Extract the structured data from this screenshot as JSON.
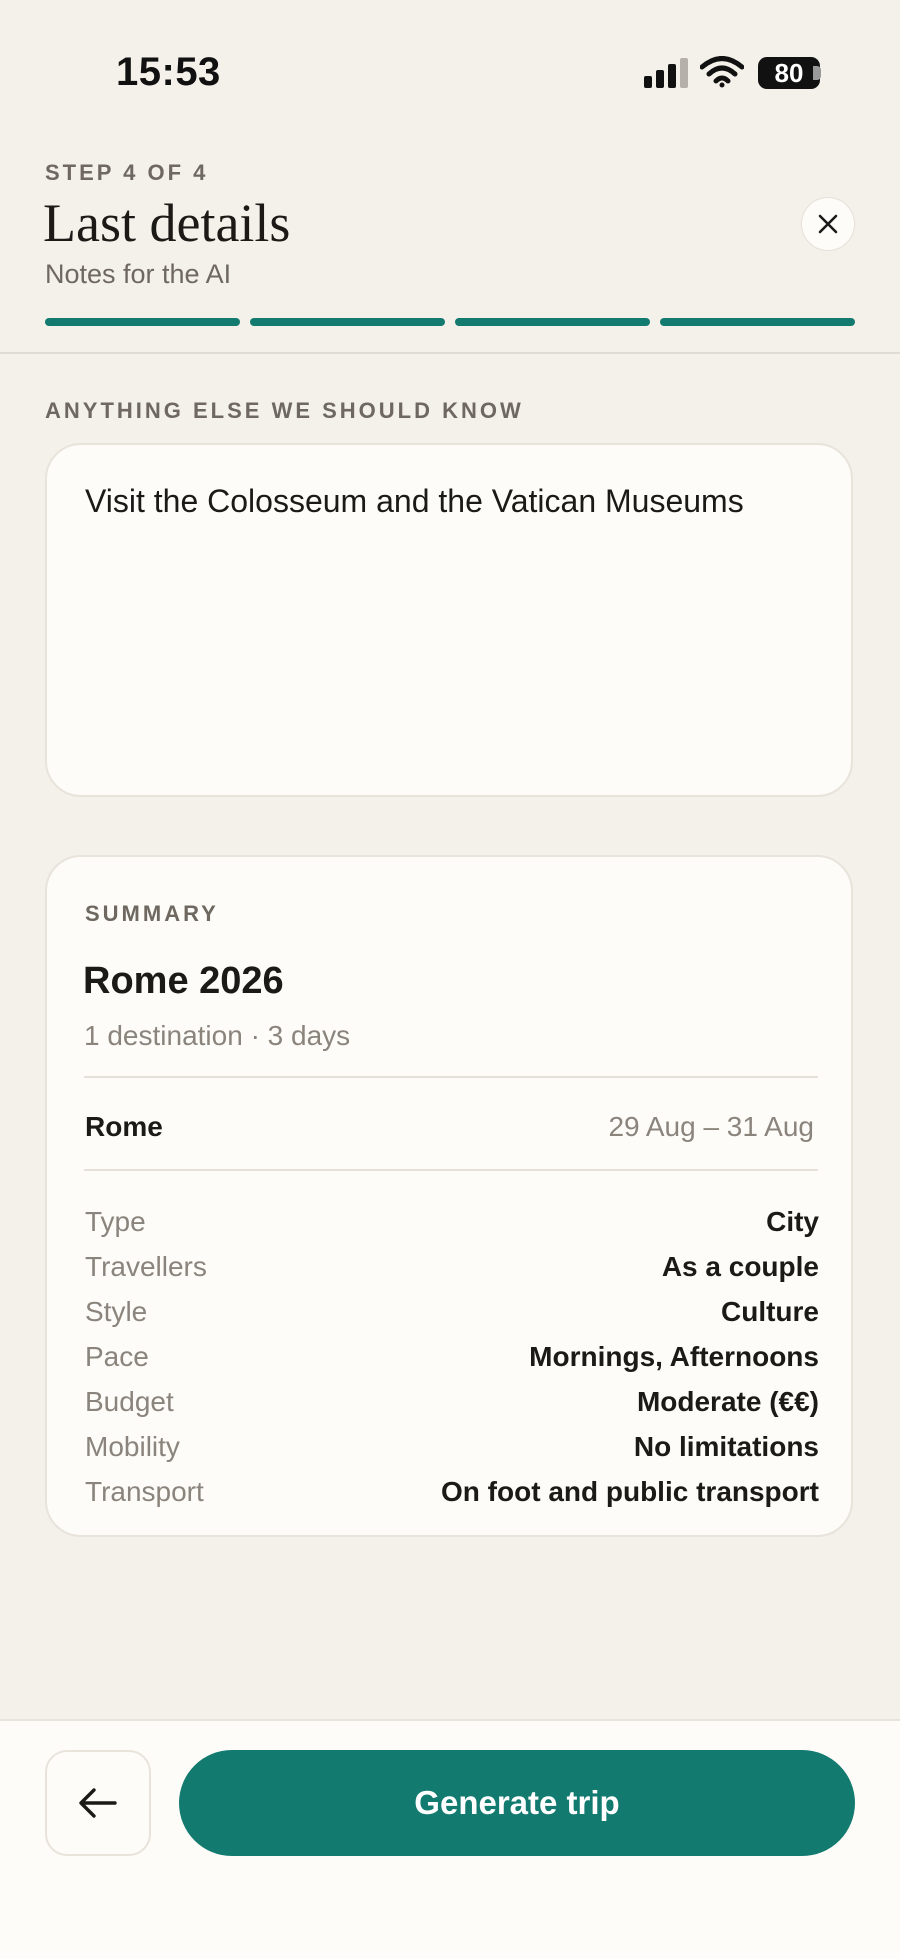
{
  "status_bar": {
    "time": "15:53",
    "battery": "80"
  },
  "header": {
    "step": "STEP 4 OF 4",
    "title": "Last details",
    "subtitle": "Notes for the AI",
    "progress_total": 4,
    "progress_completed": 4,
    "accent_color": "#137a70"
  },
  "notes": {
    "label": "ANYTHING ELSE WE SHOULD KNOW",
    "value": "Visit the Colosseum and the Vatican Museums"
  },
  "summary": {
    "label": "SUMMARY",
    "trip_name": "Rome 2026",
    "trip_meta": "1 destination · 3 days",
    "destination": {
      "name": "Rome",
      "dates": "29 Aug – 31 Aug"
    },
    "details": [
      {
        "label": "Type",
        "value": "City"
      },
      {
        "label": "Travellers",
        "value": "As a couple"
      },
      {
        "label": "Style",
        "value": "Culture"
      },
      {
        "label": "Pace",
        "value": "Mornings, Afternoons"
      },
      {
        "label": "Budget",
        "value": "Moderate (€€)"
      },
      {
        "label": "Mobility",
        "value": "No limitations"
      },
      {
        "label": "Transport",
        "value": "On foot and public transport"
      }
    ]
  },
  "footer": {
    "back_icon": "arrow-left-icon",
    "generate_label": "Generate trip"
  }
}
